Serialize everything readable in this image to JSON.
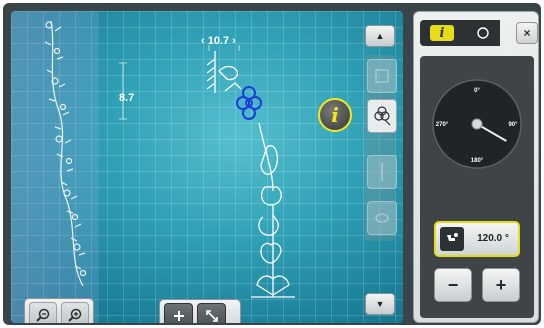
{
  "canvas": {
    "width_label": "‹ 10.7 ›",
    "height_label": "8.7",
    "info_label": "i"
  },
  "panel": {
    "tab_info_label": "i",
    "close_label": "×",
    "dial": {
      "angle_0": "0°",
      "angle_90": "90°",
      "angle_180": "180°",
      "angle_270": "270°"
    },
    "rotation_value": "120.0 °",
    "minus_label": "−",
    "plus_label": "+"
  },
  "column": {
    "up_label": "▲",
    "down_label": "▼"
  },
  "colors": {
    "accent_yellow": "#e6dc17",
    "canvas_teal": "#2fa0b5",
    "selected_motif_blue": "#1a3fd8",
    "frame_dark": "#3a4548"
  },
  "icons": {
    "zoom_out": "zoom-out-icon",
    "zoom_in": "zoom-in-icon",
    "move": "move-plus-icon",
    "resize": "resize-diagonal-icon",
    "reset": "reset-circle-icon",
    "rotate": "rotate-hand-icon",
    "motif": "flower-motif-icon"
  }
}
